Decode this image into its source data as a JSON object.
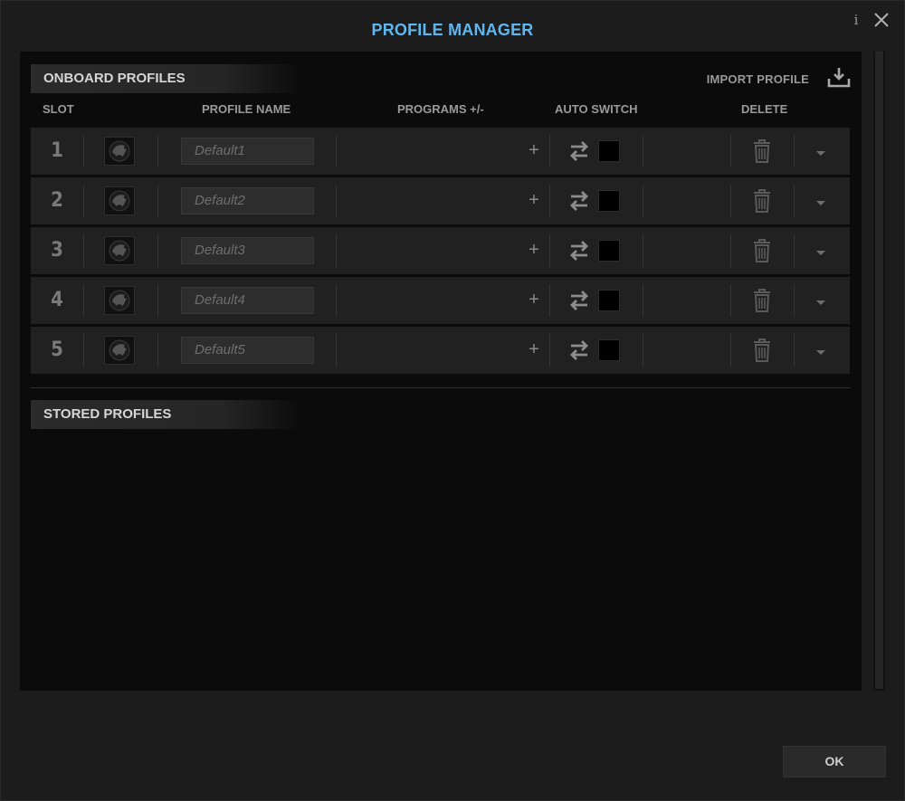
{
  "window": {
    "title": "PROFILE MANAGER",
    "info_glyph": "i"
  },
  "onboard": {
    "header": "ONBOARD PROFILES",
    "import_label": "IMPORT PROFILE",
    "columns": {
      "slot": "SLOT",
      "profile_name": "PROFILE NAME",
      "programs": "PROGRAMS +/-",
      "auto_switch": "AUTO SWITCH",
      "delete": "DELETE"
    },
    "rows": [
      {
        "slot": "1",
        "name": "Default1",
        "plus": "+",
        "auto_switch": false
      },
      {
        "slot": "2",
        "name": "Default2",
        "plus": "+",
        "auto_switch": false
      },
      {
        "slot": "3",
        "name": "Default3",
        "plus": "+",
        "auto_switch": false
      },
      {
        "slot": "4",
        "name": "Default4",
        "plus": "+",
        "auto_switch": false
      },
      {
        "slot": "5",
        "name": "Default5",
        "plus": "+",
        "auto_switch": false
      }
    ]
  },
  "stored": {
    "header": "STORED PROFILES"
  },
  "footer": {
    "ok_label": "OK"
  },
  "colors": {
    "accent": "#5fb7f0",
    "panel": "#0b0b0b",
    "row": "#212121"
  },
  "icons": [
    "info-icon",
    "close-icon",
    "import-icon",
    "profile-avatar-icon",
    "auto-switch-icon",
    "trash-icon",
    "chevron-down-icon"
  ]
}
